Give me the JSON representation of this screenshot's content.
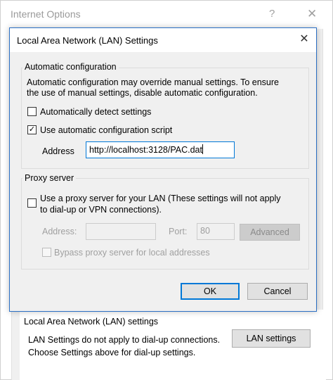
{
  "parent": {
    "title": "Internet Options",
    "help_glyph": "?",
    "close_glyph": "✕",
    "lan_group_title": "Local Area Network (LAN) settings",
    "lan_group_text": "LAN Settings do not apply to dial-up connections. Choose Settings above for dial-up settings.",
    "lan_settings_button": "LAN settings"
  },
  "dialog": {
    "title": "Local Area Network (LAN) Settings",
    "close_glyph": "✕",
    "auto_config": {
      "legend": "Automatic configuration",
      "description_line1": "Automatic configuration may override manual settings.  To ensure",
      "description_line2": "the use of manual settings, disable automatic configuration.",
      "detect_label": "Automatically detect settings",
      "detect_checked": false,
      "script_label": "Use automatic configuration script",
      "script_checked": true,
      "address_label": "Address",
      "address_value": "http://localhost:3128/PAC.dat"
    },
    "proxy": {
      "legend": "Proxy server",
      "use_proxy_line1": "Use a proxy server for your LAN (These settings will not apply",
      "use_proxy_line2": "to dial-up or VPN connections).",
      "use_proxy_checked": false,
      "address_label": "Address:",
      "address_value": "",
      "port_label": "Port:",
      "port_value": "80",
      "advanced_button": "Advanced",
      "bypass_label": "Bypass proxy server for local addresses",
      "bypass_checked": false
    },
    "ok_button": "OK",
    "cancel_button": "Cancel"
  },
  "icons": {
    "checkmark": "✓"
  },
  "colors": {
    "accent": "#0078d7",
    "dialog_border": "#2b6fc4",
    "dialog_bg": "#f0f0f0",
    "disabled_text": "#a0a0a0"
  }
}
